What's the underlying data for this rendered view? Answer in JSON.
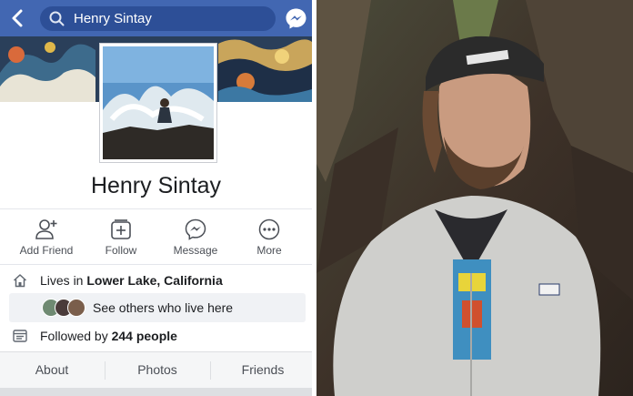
{
  "header": {
    "search_value": "Henry Sintay",
    "back_icon": "chevron-left-icon",
    "messenger_icon": "messenger-icon"
  },
  "profile": {
    "name": "Henry Sintay"
  },
  "actions": [
    {
      "label": "Add Friend",
      "icon": "add-friend-icon"
    },
    {
      "label": "Follow",
      "icon": "follow-icon"
    },
    {
      "label": "Message",
      "icon": "messenger-icon"
    },
    {
      "label": "More",
      "icon": "more-icon"
    }
  ],
  "info": {
    "lives_prefix": "Lives in ",
    "lives_place": "Lower Lake, California",
    "others_text": "See others who live here",
    "followed_prefix": "Followed by ",
    "followed_count": "244 people"
  },
  "tabs": [
    "About",
    "Photos",
    "Friends"
  ],
  "colors": {
    "brand_blue": "#4267b2",
    "search_bg": "#2d4f97",
    "text_dark": "#1c1e21",
    "text_muted": "#4b4f56"
  }
}
